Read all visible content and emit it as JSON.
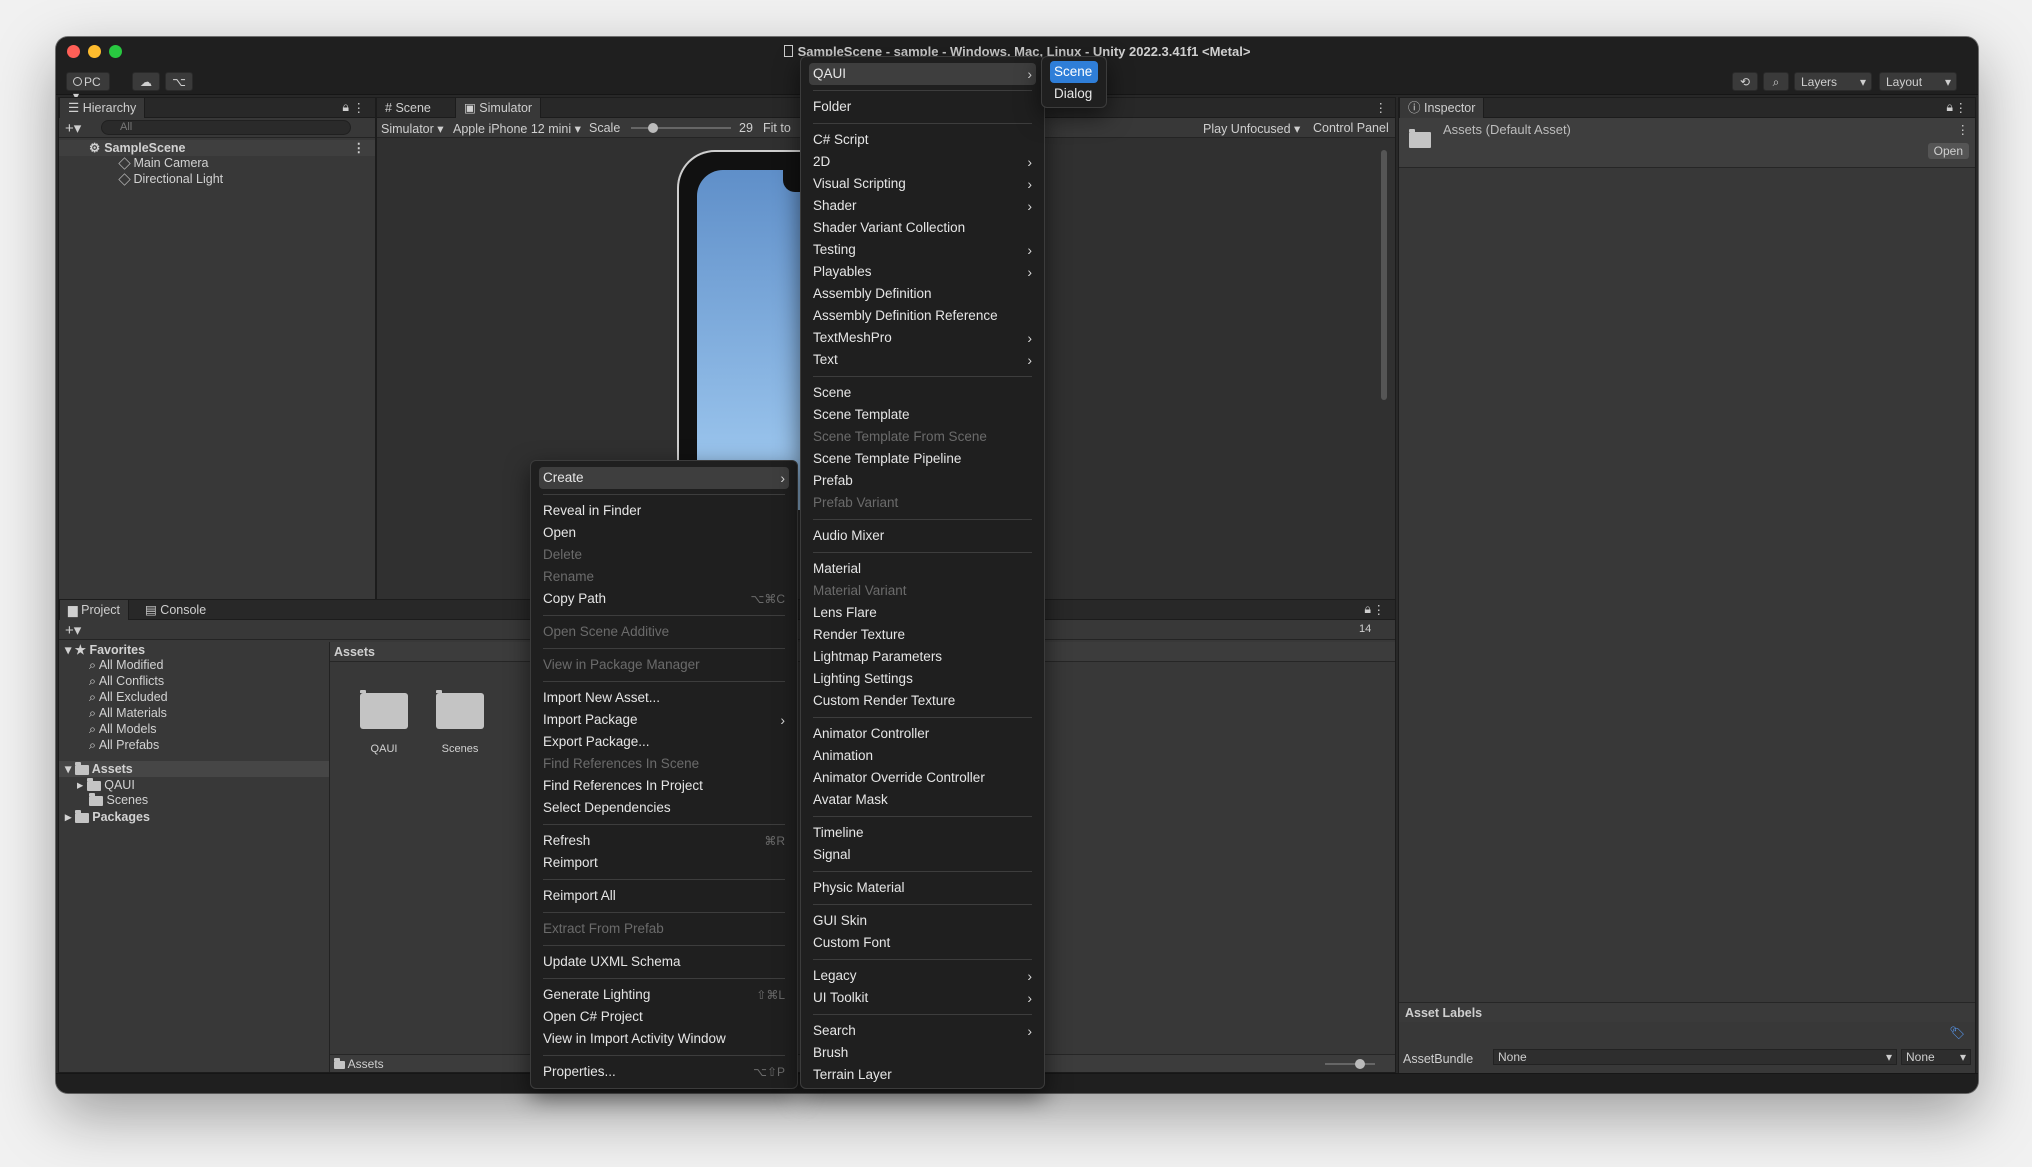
{
  "window": {
    "title": "SampleScene - sample - Windows, Mac, Linux - Unity 2022.3.41f1 <Metal>"
  },
  "toolbar": {
    "platform": "PC",
    "layers": "Layers",
    "layout": "Layout"
  },
  "hierarchy": {
    "tab": "Hierarchy",
    "search_placeholder": "All",
    "scene": "SampleScene",
    "items": [
      "Main Camera",
      "Directional Light"
    ]
  },
  "scene_view": {
    "tabs": [
      "Scene",
      "Simulator"
    ],
    "mode": "Simulator",
    "device": "Apple iPhone 12 mini",
    "scale_label": "Scale",
    "scale_value": "29",
    "fit": "Fit to",
    "play_mode": "Play Unfocused",
    "control_panel": "Control Panel"
  },
  "inspector": {
    "tab": "Inspector",
    "asset": "Assets (Default Asset)",
    "open_button": "Open",
    "asset_labels": "Asset Labels",
    "asset_bundle_label": "AssetBundle",
    "bundle_value": "None",
    "variant_value": "None"
  },
  "project": {
    "tabs": [
      "Project",
      "Console"
    ],
    "favorites_label": "Favorites",
    "favorites": [
      "All Modified",
      "All Conflicts",
      "All Excluded",
      "All Materials",
      "All Models",
      "All Prefabs"
    ],
    "assets_label": "Assets",
    "assets_children": [
      "QAUI",
      "Scenes"
    ],
    "packages_label": "Packages",
    "breadcrumb": "Assets",
    "grid_items": [
      "QAUI",
      "Scenes"
    ],
    "footer_path": "Assets",
    "badge_count": "14"
  },
  "context_menu": {
    "items": [
      {
        "label": "Create",
        "state": "highlight",
        "arrow": true
      },
      {
        "label": "Reveal in Finder"
      },
      {
        "label": "Open"
      },
      {
        "label": "Delete",
        "state": "disabled"
      },
      {
        "label": "Rename",
        "state": "disabled"
      },
      {
        "label": "Copy Path",
        "shortcut": "⌥⌘C"
      },
      {
        "label": "Open Scene Additive",
        "state": "disabled"
      },
      {
        "label": "View in Package Manager",
        "state": "disabled"
      },
      {
        "label": "Import New Asset..."
      },
      {
        "label": "Import Package",
        "arrow": true
      },
      {
        "label": "Export Package..."
      },
      {
        "label": "Find References In Scene",
        "state": "disabled"
      },
      {
        "label": "Find References In Project"
      },
      {
        "label": "Select Dependencies"
      },
      {
        "label": "Refresh",
        "shortcut": "⌘R"
      },
      {
        "label": "Reimport"
      },
      {
        "label": "Reimport All"
      },
      {
        "label": "Extract From Prefab",
        "state": "disabled"
      },
      {
        "label": "Update UXML Schema"
      },
      {
        "label": "Generate Lighting",
        "shortcut": "⇧⌘L"
      },
      {
        "label": "Open C# Project"
      },
      {
        "label": "View in Import Activity Window"
      },
      {
        "label": "Properties...",
        "shortcut": "⌥⇧P"
      }
    ]
  },
  "create_menu": {
    "items": [
      {
        "label": "QAUI",
        "state": "highlight",
        "arrow": true
      },
      {
        "label": "Folder"
      },
      {
        "label": "C# Script"
      },
      {
        "label": "2D",
        "arrow": true
      },
      {
        "label": "Visual Scripting",
        "arrow": true
      },
      {
        "label": "Shader",
        "arrow": true
      },
      {
        "label": "Shader Variant Collection"
      },
      {
        "label": "Testing",
        "arrow": true
      },
      {
        "label": "Playables",
        "arrow": true
      },
      {
        "label": "Assembly Definition"
      },
      {
        "label": "Assembly Definition Reference"
      },
      {
        "label": "TextMeshPro",
        "arrow": true
      },
      {
        "label": "Text",
        "arrow": true
      },
      {
        "label": "Scene"
      },
      {
        "label": "Scene Template"
      },
      {
        "label": "Scene Template From Scene",
        "state": "disabled"
      },
      {
        "label": "Scene Template Pipeline"
      },
      {
        "label": "Prefab"
      },
      {
        "label": "Prefab Variant",
        "state": "disabled"
      },
      {
        "label": "Audio Mixer"
      },
      {
        "label": "Material"
      },
      {
        "label": "Material Variant",
        "state": "disabled"
      },
      {
        "label": "Lens Flare"
      },
      {
        "label": "Render Texture"
      },
      {
        "label": "Lightmap Parameters"
      },
      {
        "label": "Lighting Settings"
      },
      {
        "label": "Custom Render Texture"
      },
      {
        "label": "Animator Controller"
      },
      {
        "label": "Animation"
      },
      {
        "label": "Animator Override Controller"
      },
      {
        "label": "Avatar Mask"
      },
      {
        "label": "Timeline"
      },
      {
        "label": "Signal"
      },
      {
        "label": "Physic Material"
      },
      {
        "label": "GUI Skin"
      },
      {
        "label": "Custom Font"
      },
      {
        "label": "Legacy",
        "arrow": true
      },
      {
        "label": "UI Toolkit",
        "arrow": true
      },
      {
        "label": "Search",
        "arrow": true
      },
      {
        "label": "Brush"
      },
      {
        "label": "Terrain Layer"
      }
    ]
  },
  "qaui_menu": {
    "items": [
      {
        "label": "Scene",
        "state": "selected"
      },
      {
        "label": "Dialog"
      }
    ]
  }
}
